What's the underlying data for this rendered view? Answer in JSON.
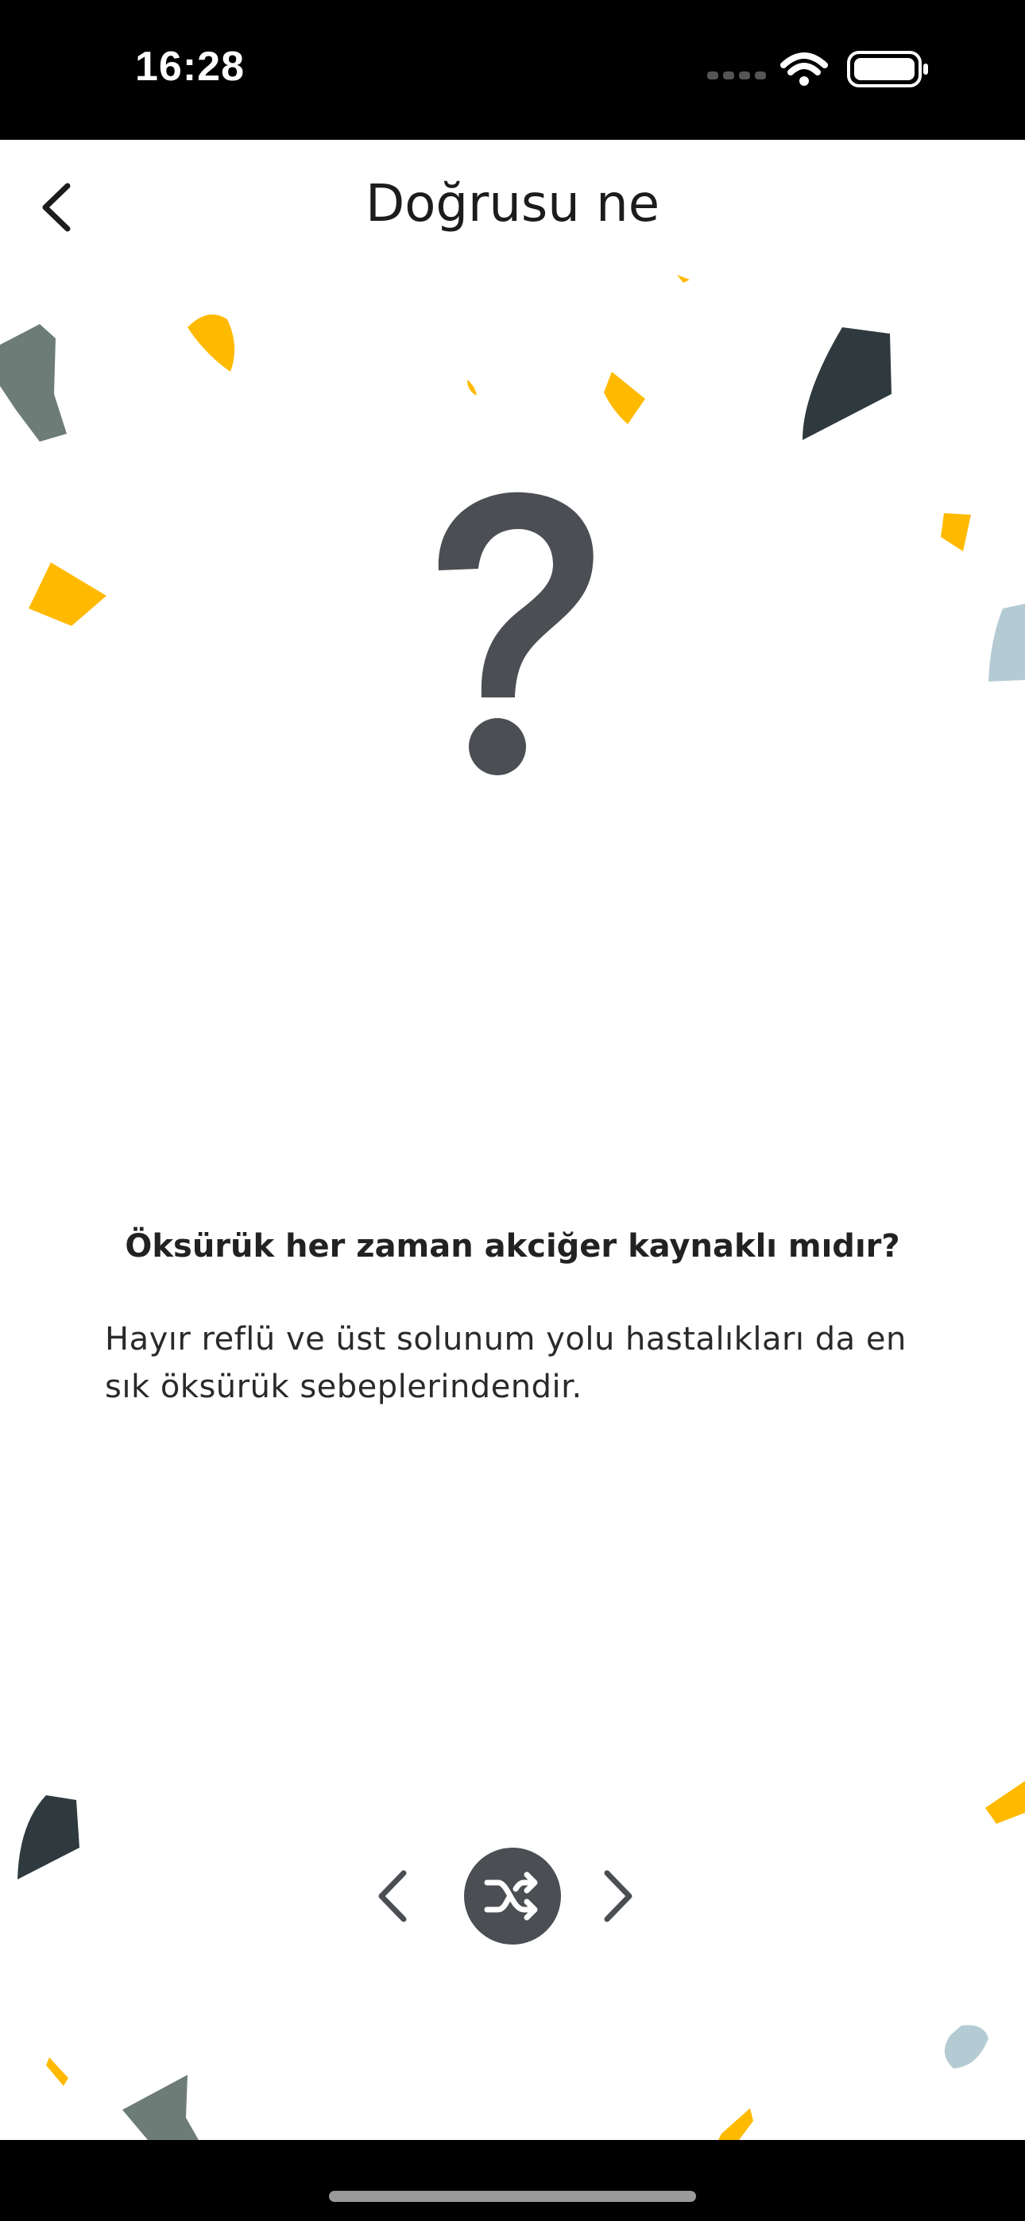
{
  "status_bar": {
    "time": "16:28",
    "icons": [
      "signal-icon",
      "wifi-icon",
      "battery-icon"
    ]
  },
  "nav": {
    "title": "Doğrusu ne",
    "back_icon": "chevron-left-icon"
  },
  "card": {
    "icon": "question-mark-icon",
    "question": "Öksürük her zaman akciğer kaynaklı mıdır?",
    "answer": "Hayır reflü ve üst solunum yolu hastalıkları da en sık öksürük sebeplerindendir."
  },
  "controls": {
    "prev_icon": "chevron-left-icon",
    "shuffle_icon": "shuffle-icon",
    "next_icon": "chevron-right-icon"
  },
  "colors": {
    "accent_yellow": "#FFBA00",
    "dark_slate": "#2F3A3F",
    "grey_green": "#6E7C77",
    "light_blue": "#B5CBD3",
    "icon_grey": "#4B4E53"
  }
}
